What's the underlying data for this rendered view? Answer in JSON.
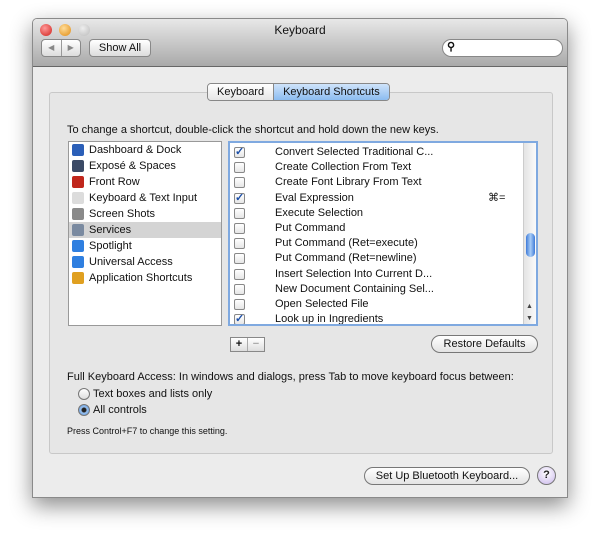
{
  "window": {
    "title": "Keyboard"
  },
  "toolbar": {
    "back": "◀",
    "forward": "▶",
    "show_all": "Show All",
    "search_placeholder": ""
  },
  "tabs": [
    {
      "label": "Keyboard",
      "selected": false
    },
    {
      "label": "Keyboard Shortcuts",
      "selected": true
    }
  ],
  "instruction": "To change a shortcut, double-click the shortcut and hold down the new keys.",
  "categories": [
    {
      "label": "Dashboard & Dock",
      "icon": "dashboard-icon",
      "color": "#2b5fb8"
    },
    {
      "label": "Exposé & Spaces",
      "icon": "expose-icon",
      "color": "#3b4a66"
    },
    {
      "label": "Front Row",
      "icon": "front-row-icon",
      "color": "#c0261c"
    },
    {
      "label": "Keyboard & Text Input",
      "icon": "keyboard-icon",
      "color": "#dcdcdc"
    },
    {
      "label": "Screen Shots",
      "icon": "screenshot-icon",
      "color": "#8a8a8a"
    },
    {
      "label": "Services",
      "icon": "gear-icon",
      "color": "#7a8aa0",
      "selected": true
    },
    {
      "label": "Spotlight",
      "icon": "spotlight-icon",
      "color": "#2f7fe0"
    },
    {
      "label": "Universal Access",
      "icon": "universal-access-icon",
      "color": "#2f7fe0"
    },
    {
      "label": "Application Shortcuts",
      "icon": "app-shortcuts-icon",
      "color": "#e0a020"
    }
  ],
  "shortcuts": [
    {
      "label": "Convert Selected Traditional C...",
      "checked": true,
      "key": ""
    },
    {
      "label": "Create Collection From Text",
      "checked": false,
      "key": ""
    },
    {
      "label": "Create Font Library From Text",
      "checked": false,
      "key": ""
    },
    {
      "label": "Eval Expression",
      "checked": true,
      "key": "⌘="
    },
    {
      "label": "Execute Selection",
      "checked": false,
      "key": ""
    },
    {
      "label": "Put Command",
      "checked": false,
      "key": ""
    },
    {
      "label": "Put Command (Ret=execute)",
      "checked": false,
      "key": ""
    },
    {
      "label": "Put Command (Ret=newline)",
      "checked": false,
      "key": ""
    },
    {
      "label": "Insert Selection Into Current D...",
      "checked": false,
      "key": ""
    },
    {
      "label": "New Document Containing Sel...",
      "checked": false,
      "key": ""
    },
    {
      "label": "Open Selected File",
      "checked": false,
      "key": ""
    },
    {
      "label": "Look up in Ingredients",
      "checked": true,
      "key": ""
    }
  ],
  "buttons": {
    "add": "+",
    "remove": "−",
    "restore": "Restore Defaults",
    "bluetooth": "Set Up Bluetooth Keyboard...",
    "help": "?"
  },
  "fka": {
    "label": "Full Keyboard Access: In windows and dialogs, press Tab to move keyboard focus between:",
    "options": [
      {
        "label": "Text boxes and lists only",
        "selected": false
      },
      {
        "label": "All controls",
        "selected": true
      }
    ],
    "hint": "Press Control+F7 to change this setting."
  },
  "colors": {
    "accent": "#6fa6e6",
    "checkmark": "#1c4fa8"
  }
}
